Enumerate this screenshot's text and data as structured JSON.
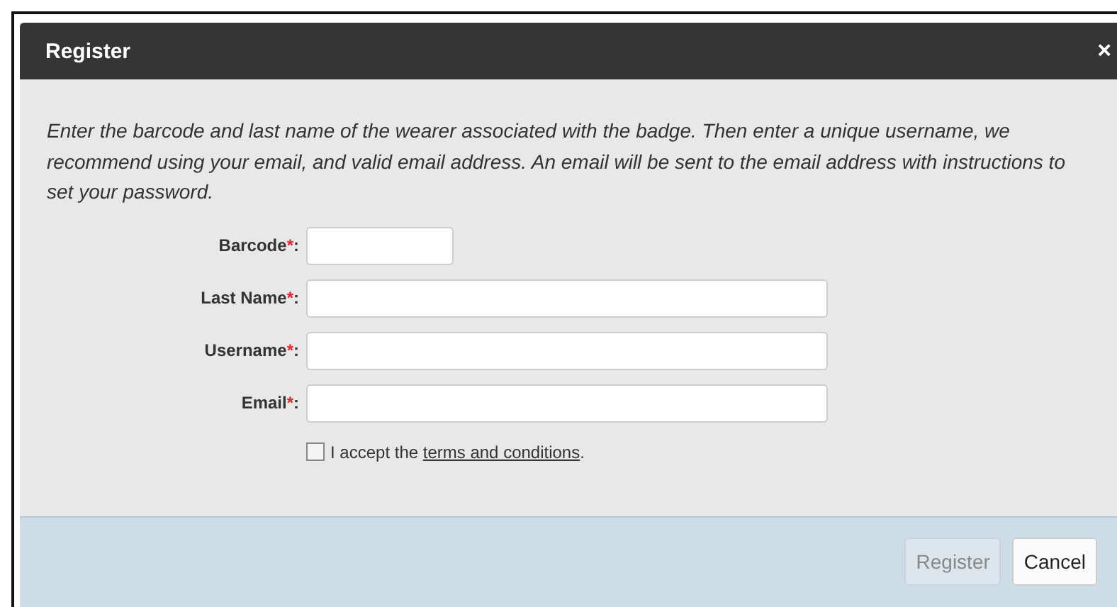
{
  "dialog": {
    "title": "Register",
    "close": "×"
  },
  "instructions": "Enter the barcode and last name of the wearer associated with the badge. Then enter a unique username, we recommend using your email, and valid email address. An email will be sent to the email address with instructions to set your password.",
  "fields": [
    {
      "label": "Barcode",
      "required_mark": "*",
      "colon": ":",
      "kind": "short"
    },
    {
      "label": "Last Name",
      "required_mark": "*",
      "colon": ":",
      "kind": "long"
    },
    {
      "label": "Username",
      "required_mark": "*",
      "colon": ":",
      "kind": "long"
    },
    {
      "label": "Email",
      "required_mark": "*",
      "colon": ":",
      "kind": "long"
    }
  ],
  "terms": {
    "checked": false,
    "text": "I accept the ",
    "link": "terms and conditions",
    "after": "."
  },
  "buttons": [
    {
      "label": "Register",
      "disabled": true
    },
    {
      "label": "Cancel",
      "disabled": false
    }
  ]
}
